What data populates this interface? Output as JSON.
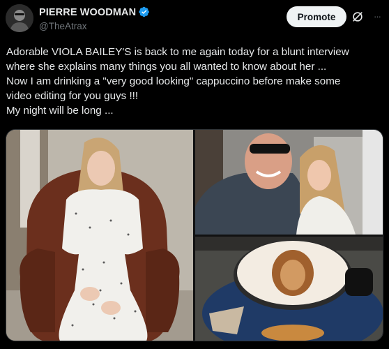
{
  "author": {
    "display_name": "PIERRE WOODMAN",
    "handle": "@TheAtrax",
    "avatar_icon": "avatar-image",
    "verified_icon": "verified-badge-icon"
  },
  "actions": {
    "promote_label": "Promote",
    "grok_icon": "grok-icon",
    "more_icon": "more-icon",
    "more_glyph": "···"
  },
  "tweet": {
    "text": "Adorable VIOLA BAILEY'S is back to me again today for a blunt interview\nwhere she explains many things you all wanted to know  about her ...\nNow I am drinking a \"very good looking\" cappuccino before make some\nvideo editing for you guys !!!\nMy night will be long ..."
  },
  "media": {
    "images": [
      "woman-in-leather-chair-photo",
      "selfie-man-and-woman-photo",
      "latte-art-cappuccino-photo"
    ]
  },
  "colors": {
    "background": "#000000",
    "text": "#e7e9ea",
    "muted": "#71767b",
    "verified": "#1d9bf0",
    "promote_bg": "#eff3f4"
  }
}
